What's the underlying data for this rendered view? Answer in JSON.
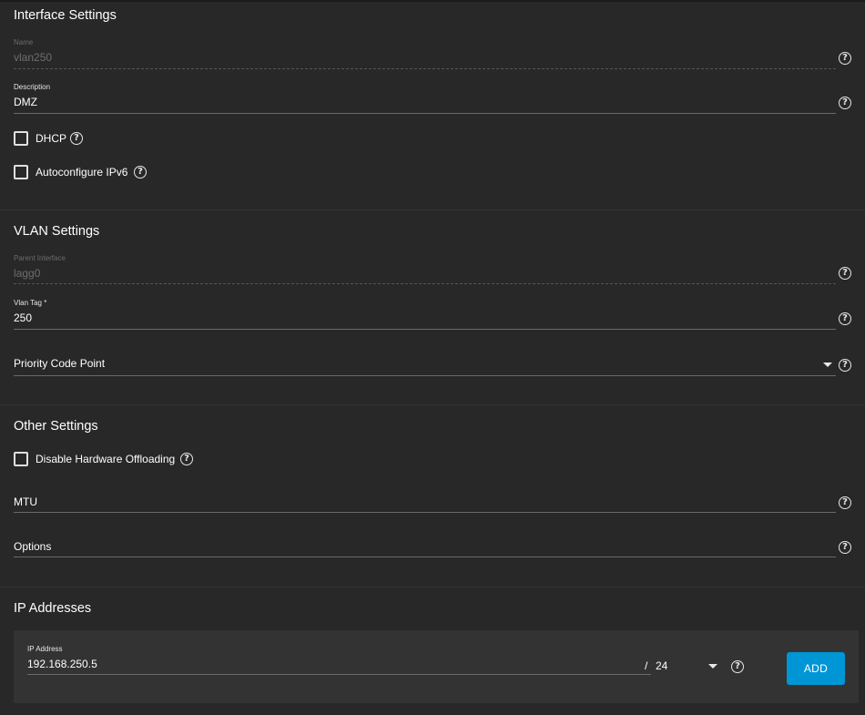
{
  "interface_settings": {
    "title": "Interface Settings",
    "name": {
      "label": "Name",
      "value": "vlan250"
    },
    "description": {
      "label": "Description",
      "value": "DMZ"
    },
    "dhcp": {
      "label": "DHCP",
      "checked": false
    },
    "autoconfigure_ipv6": {
      "label": "Autoconfigure IPv6",
      "checked": false
    }
  },
  "vlan_settings": {
    "title": "VLAN Settings",
    "parent_interface": {
      "label": "Parent Interface",
      "value": "lagg0"
    },
    "vlan_tag": {
      "label": "Vlan Tag *",
      "value": "250"
    },
    "priority_code_point": {
      "placeholder": "Priority Code Point"
    }
  },
  "other_settings": {
    "title": "Other Settings",
    "disable_hw_offloading": {
      "label": "Disable Hardware Offloading",
      "checked": false
    },
    "mtu": {
      "placeholder": "MTU"
    },
    "options": {
      "placeholder": "Options"
    }
  },
  "ip_addresses": {
    "title": "IP Addresses",
    "ip_address": {
      "label": "IP Address",
      "value": "192.168.250.5"
    },
    "separator": "/",
    "netmask": "24",
    "add_label": "ADD"
  },
  "icons": {
    "help": "help-circle-icon",
    "dropdown": "caret-down-icon",
    "help_glyph": "?"
  },
  "colors": {
    "background": "#282828",
    "card": "#333333",
    "accent": "#0095d5"
  }
}
